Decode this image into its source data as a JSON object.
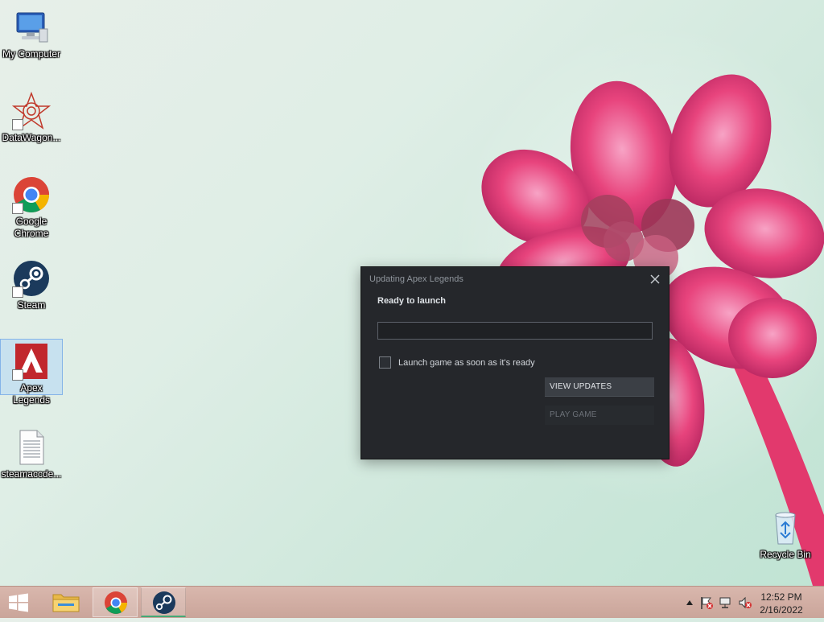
{
  "desktop": {
    "icons": [
      {
        "label": "My Computer"
      },
      {
        "label": "DataWagon..."
      },
      {
        "label": "Google Chrome"
      },
      {
        "label": "Steam"
      },
      {
        "label": "Apex Legends"
      },
      {
        "label": "steamaccde..."
      }
    ],
    "recycle_bin": {
      "label": "Recycle Bin"
    }
  },
  "dialog": {
    "title": "Updating Apex Legends",
    "status": "Ready to launch",
    "progress": 0,
    "checkbox_label": "Launch game as soon as it's ready",
    "checkbox_checked": false,
    "view_updates_label": "VIEW UPDATES",
    "play_game_label": "PLAY GAME"
  },
  "taskbar": {
    "clock_time": "12:52 PM",
    "clock_date": "2/16/2022"
  },
  "colors": {
    "dialog_bg": "#25272b",
    "accent_pink": "#e8447d",
    "steam_blue": "#1b3a5c"
  }
}
